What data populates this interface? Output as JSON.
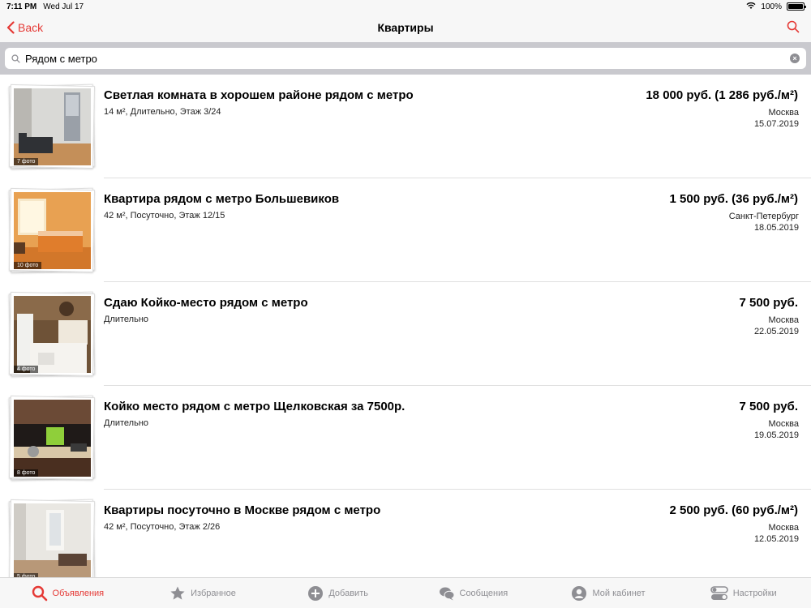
{
  "status_bar": {
    "time": "7:11 PM",
    "date": "Wed Jul 17",
    "battery": "100%",
    "battery_level": 1.0
  },
  "nav": {
    "back_label": "Back",
    "title": "Квартиры"
  },
  "search": {
    "value": "Рядом с метро",
    "clear": "×"
  },
  "listings": [
    {
      "title": "Светлая комната в хорошем районе рядом с метро",
      "details": "14 м², Длительно, Этаж 3/24",
      "price": "18 000 руб. (1 286 руб./м²)",
      "city": "Москва",
      "date": "15.07.2019",
      "photos": "7 фото"
    },
    {
      "title": "Квартира рядом с метро Большевиков",
      "details": "42 м², Посуточно, Этаж 12/15",
      "price": "1 500 руб. (36 руб./м²)",
      "city": "Санкт-Петербург",
      "date": "18.05.2019",
      "photos": "10 фото"
    },
    {
      "title": "Сдаю Койко-место рядом с метро",
      "details": "Длительно",
      "price": "7 500 руб.",
      "city": "Москва",
      "date": "22.05.2019",
      "photos": "4 фото"
    },
    {
      "title": "Койко место рядом с метро Щелковская за 7500р.",
      "details": "Длительно",
      "price": "7 500 руб.",
      "city": "Москва",
      "date": "19.05.2019",
      "photos": "8 фото"
    },
    {
      "title": "Квартиры посуточно в Москве рядом с метро",
      "details": "42 м², Посуточно, Этаж 2/26",
      "price": "2 500 руб. (60 руб./м²)",
      "city": "Москва",
      "date": "12.05.2019",
      "photos": "5 фото"
    }
  ],
  "tabs": [
    {
      "label": "Объявления",
      "icon": "search-icon",
      "active": true
    },
    {
      "label": "Избранное",
      "icon": "star-icon",
      "active": false
    },
    {
      "label": "Добавить",
      "icon": "plus-circle-icon",
      "active": false
    },
    {
      "label": "Сообщения",
      "icon": "chat-bubbles-icon",
      "active": false
    },
    {
      "label": "Мой кабинет",
      "icon": "user-icon",
      "active": false
    },
    {
      "label": "Настройки",
      "icon": "toggles-icon",
      "active": false
    }
  ],
  "colors": {
    "accent": "#e53935",
    "inactive": "#8e8e93",
    "bar_bg": "#f7f7f7",
    "search_bg": "#c9c9ce"
  }
}
